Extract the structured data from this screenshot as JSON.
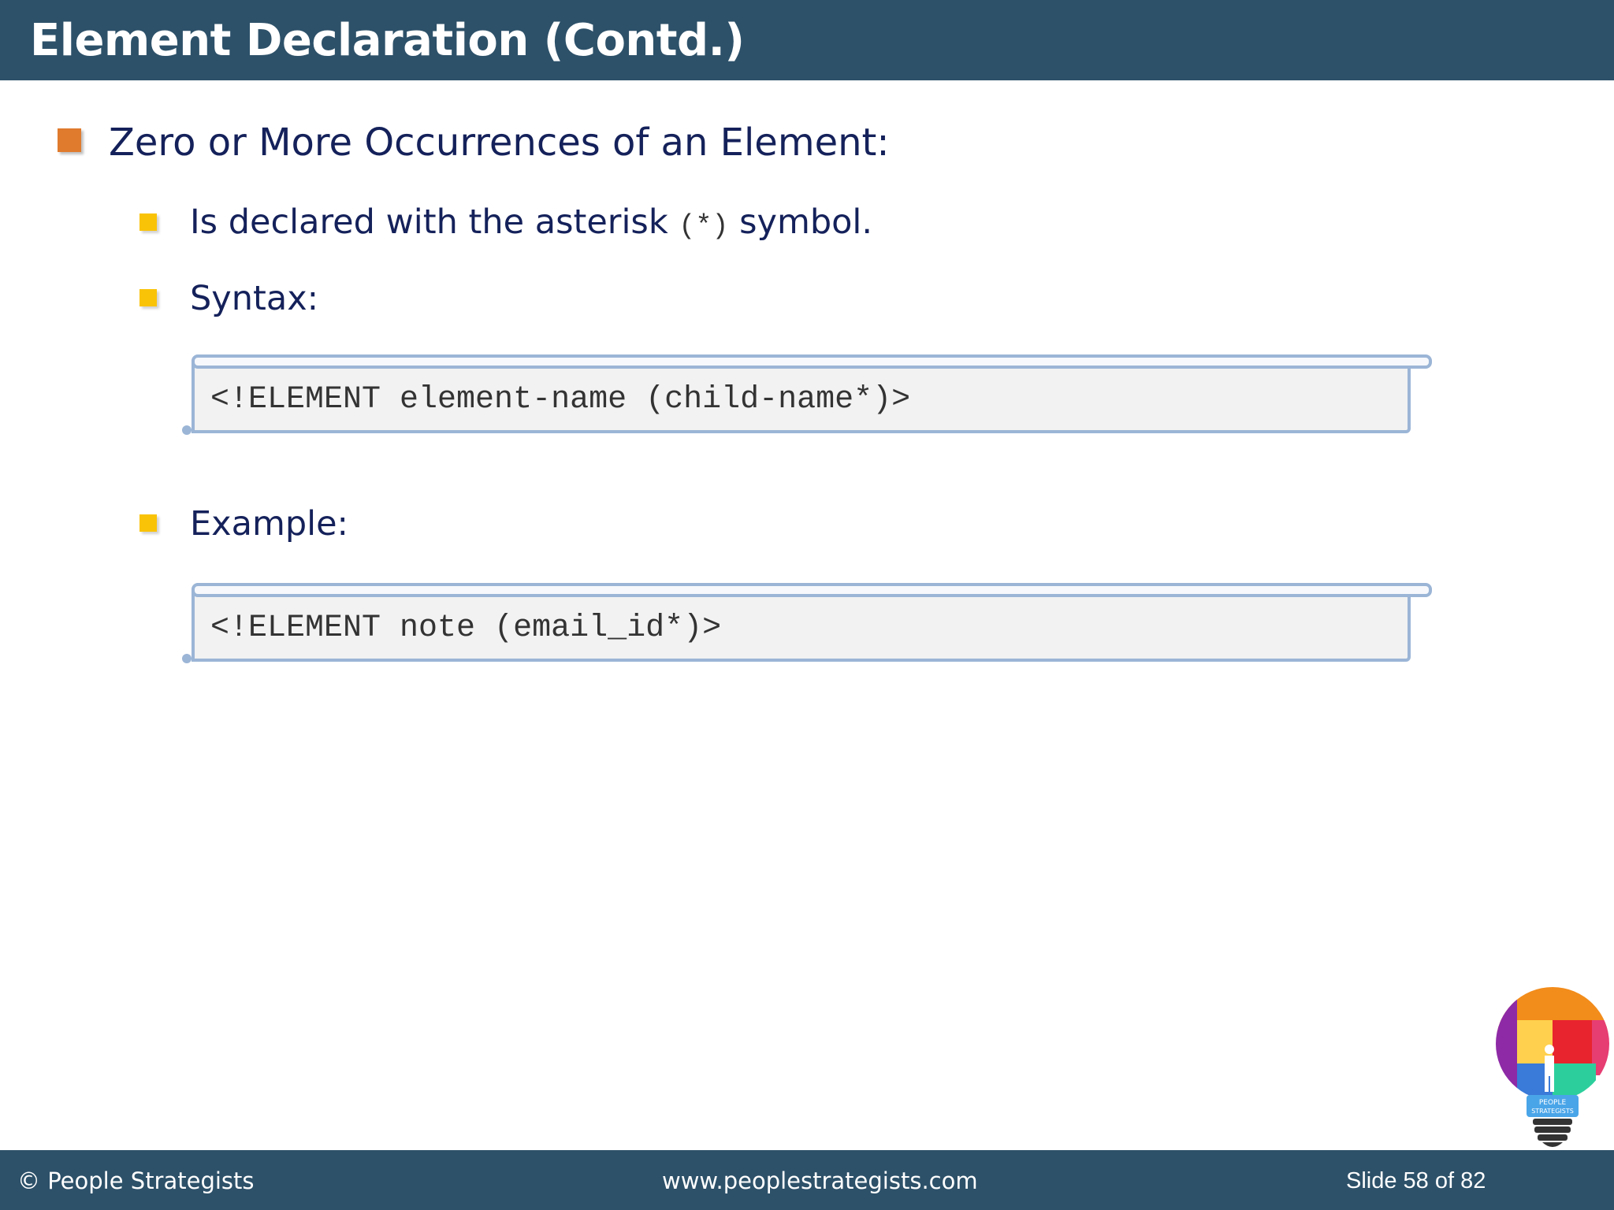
{
  "slide": {
    "title": "Element Declaration (Contd.)",
    "main_bullet": "Zero or More Occurrences of an Element:",
    "sub_bullets": {
      "declared_prefix": "Is declared with the asterisk ",
      "declared_code": "(*)",
      "declared_suffix": " symbol.",
      "syntax_label": "Syntax:",
      "syntax_code": "<!ELEMENT element-name (child-name*)>",
      "example_label": "Example:",
      "example_code": "<!ELEMENT note (email_id*)>"
    }
  },
  "footer": {
    "copyright": "© People Strategists",
    "website": "www.peoplestrategists.com",
    "slide_counter": "Slide 58 of 82"
  },
  "logo": {
    "icon": "lightbulb-puzzle-logo",
    "text_line1": "PEOPLE",
    "text_line2": "STRATEGISTS"
  },
  "colors": {
    "header_bg": "#2d5169",
    "text": "#14215a",
    "bullet_main": "#e07b2e",
    "bullet_sub": "#f9c308",
    "code_border": "#9bb5d6",
    "code_bg": "#f2f2f2"
  }
}
